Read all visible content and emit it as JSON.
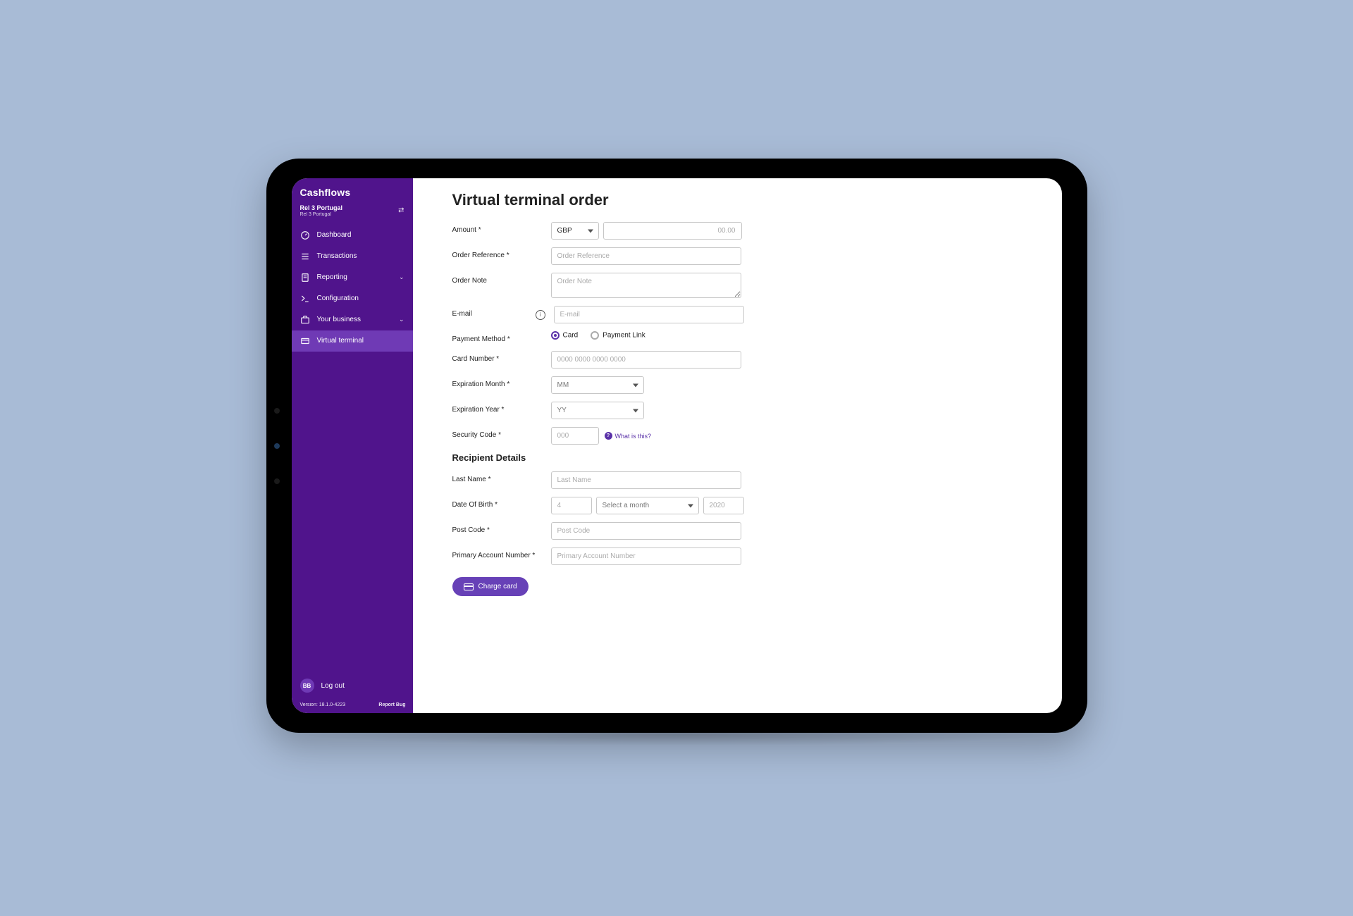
{
  "brand": "Cashflows",
  "account": {
    "line1": "Rel 3 Portugal",
    "line2": "Rel 3 Portugal"
  },
  "nav": {
    "dashboard": "Dashboard",
    "transactions": "Transactions",
    "reporting": "Reporting",
    "configuration": "Configuration",
    "yourBusiness": "Your business",
    "virtualTerminal": "Virtual terminal"
  },
  "logout": {
    "avatar": "BB",
    "label": "Log out"
  },
  "footer": {
    "version": "Version: 18.1.0-4223",
    "reportBug": "Report Bug"
  },
  "page": {
    "title": "Virtual terminal order",
    "labels": {
      "amount": "Amount *",
      "orderRef": "Order Reference *",
      "orderNote": "Order Note",
      "email": "E-mail",
      "paymentMethod": "Payment Method *",
      "cardNumber": "Card Number *",
      "expMonth": "Expiration Month *",
      "expYear": "Expiration Year *",
      "securityCode": "Security Code *",
      "recipientHeader": "Recipient Details",
      "lastName": "Last Name *",
      "dob": "Date Of Birth *",
      "postCode": "Post Code *",
      "pan": "Primary Account Number *"
    },
    "currency": "GBP",
    "placeholders": {
      "amount": "00.00",
      "orderRef": "Order Reference",
      "orderNote": "Order Note",
      "email": "E-mail",
      "cardNumber": "0000 0000 0000 0000",
      "expMonth": "MM",
      "expYear": "YY",
      "securityCode": "000",
      "lastName": "Last Name",
      "dobDay": "4",
      "dobMonth": "Select a month",
      "dobYear": "2020",
      "postCode": "Post Code",
      "pan": "Primary Account Number"
    },
    "paymentOptions": {
      "card": "Card",
      "link": "Payment Link"
    },
    "whatIsThis": "What is this?",
    "chargeBtn": "Charge card"
  }
}
